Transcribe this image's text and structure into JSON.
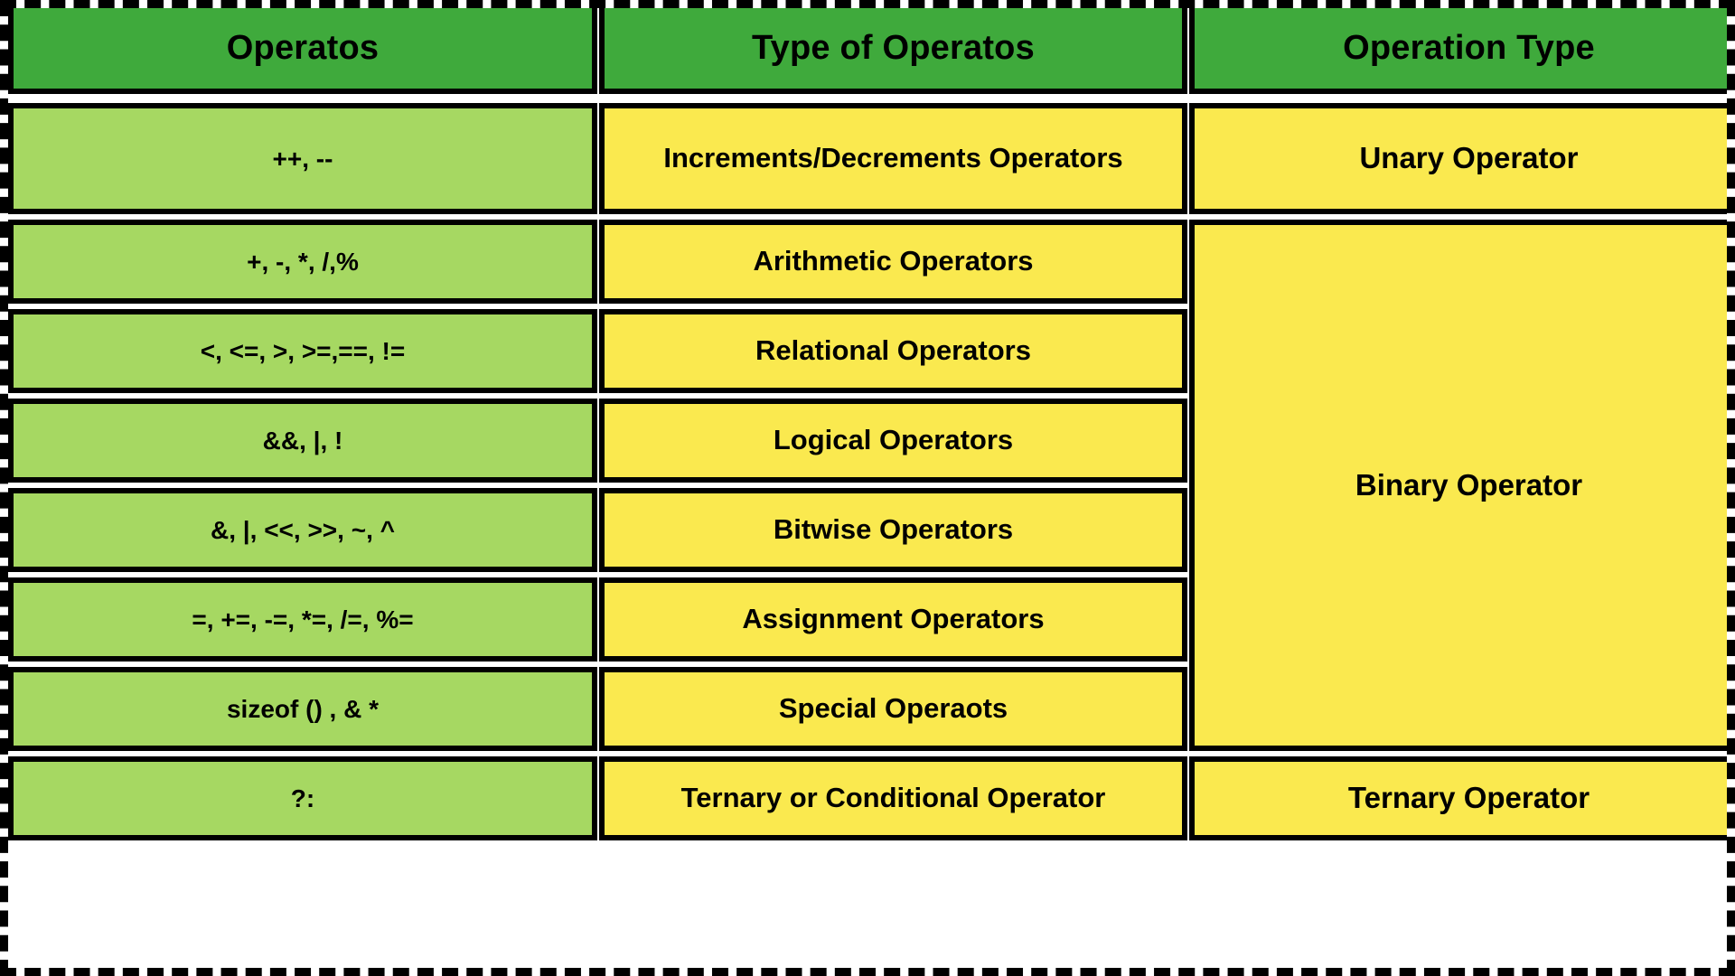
{
  "table": {
    "headers": [
      {
        "label": "Operatos"
      },
      {
        "label": "Type of Operatos"
      },
      {
        "label": "Operation Type"
      }
    ],
    "rows": [
      {
        "operators": "++, --",
        "type": "Increments/Decrements Operators"
      },
      {
        "operators": "+, -, *, /,%",
        "type": "Arithmetic Operators"
      },
      {
        "operators": "<, <=, >, >=,==, !=",
        "type": "Relational Operators"
      },
      {
        "operators": "&&, |, !",
        "type": "Logical Operators"
      },
      {
        "operators": "&, |, <<, >>, ~, ^",
        "type": "Bitwise Operators"
      },
      {
        "operators": "=, +=, -=, *=, /=, %=",
        "type": "Assignment Operators"
      },
      {
        "operators": "sizeof () , & *",
        "type": "Special Operaots"
      },
      {
        "operators": "?:",
        "type": "Ternary or Conditional Operator"
      }
    ],
    "operation_types": [
      {
        "label": "Unary Operator",
        "spans_rows": 1
      },
      {
        "label": "Binary Operator",
        "spans_rows": 6
      },
      {
        "label": "Ternary Operator",
        "spans_rows": 1
      }
    ],
    "colors": {
      "header_green": "#3faa3c",
      "operators_green": "#a6d862",
      "type_yellow": "#fae94f",
      "border_black": "#000000",
      "page_background": "#ffffff"
    }
  }
}
